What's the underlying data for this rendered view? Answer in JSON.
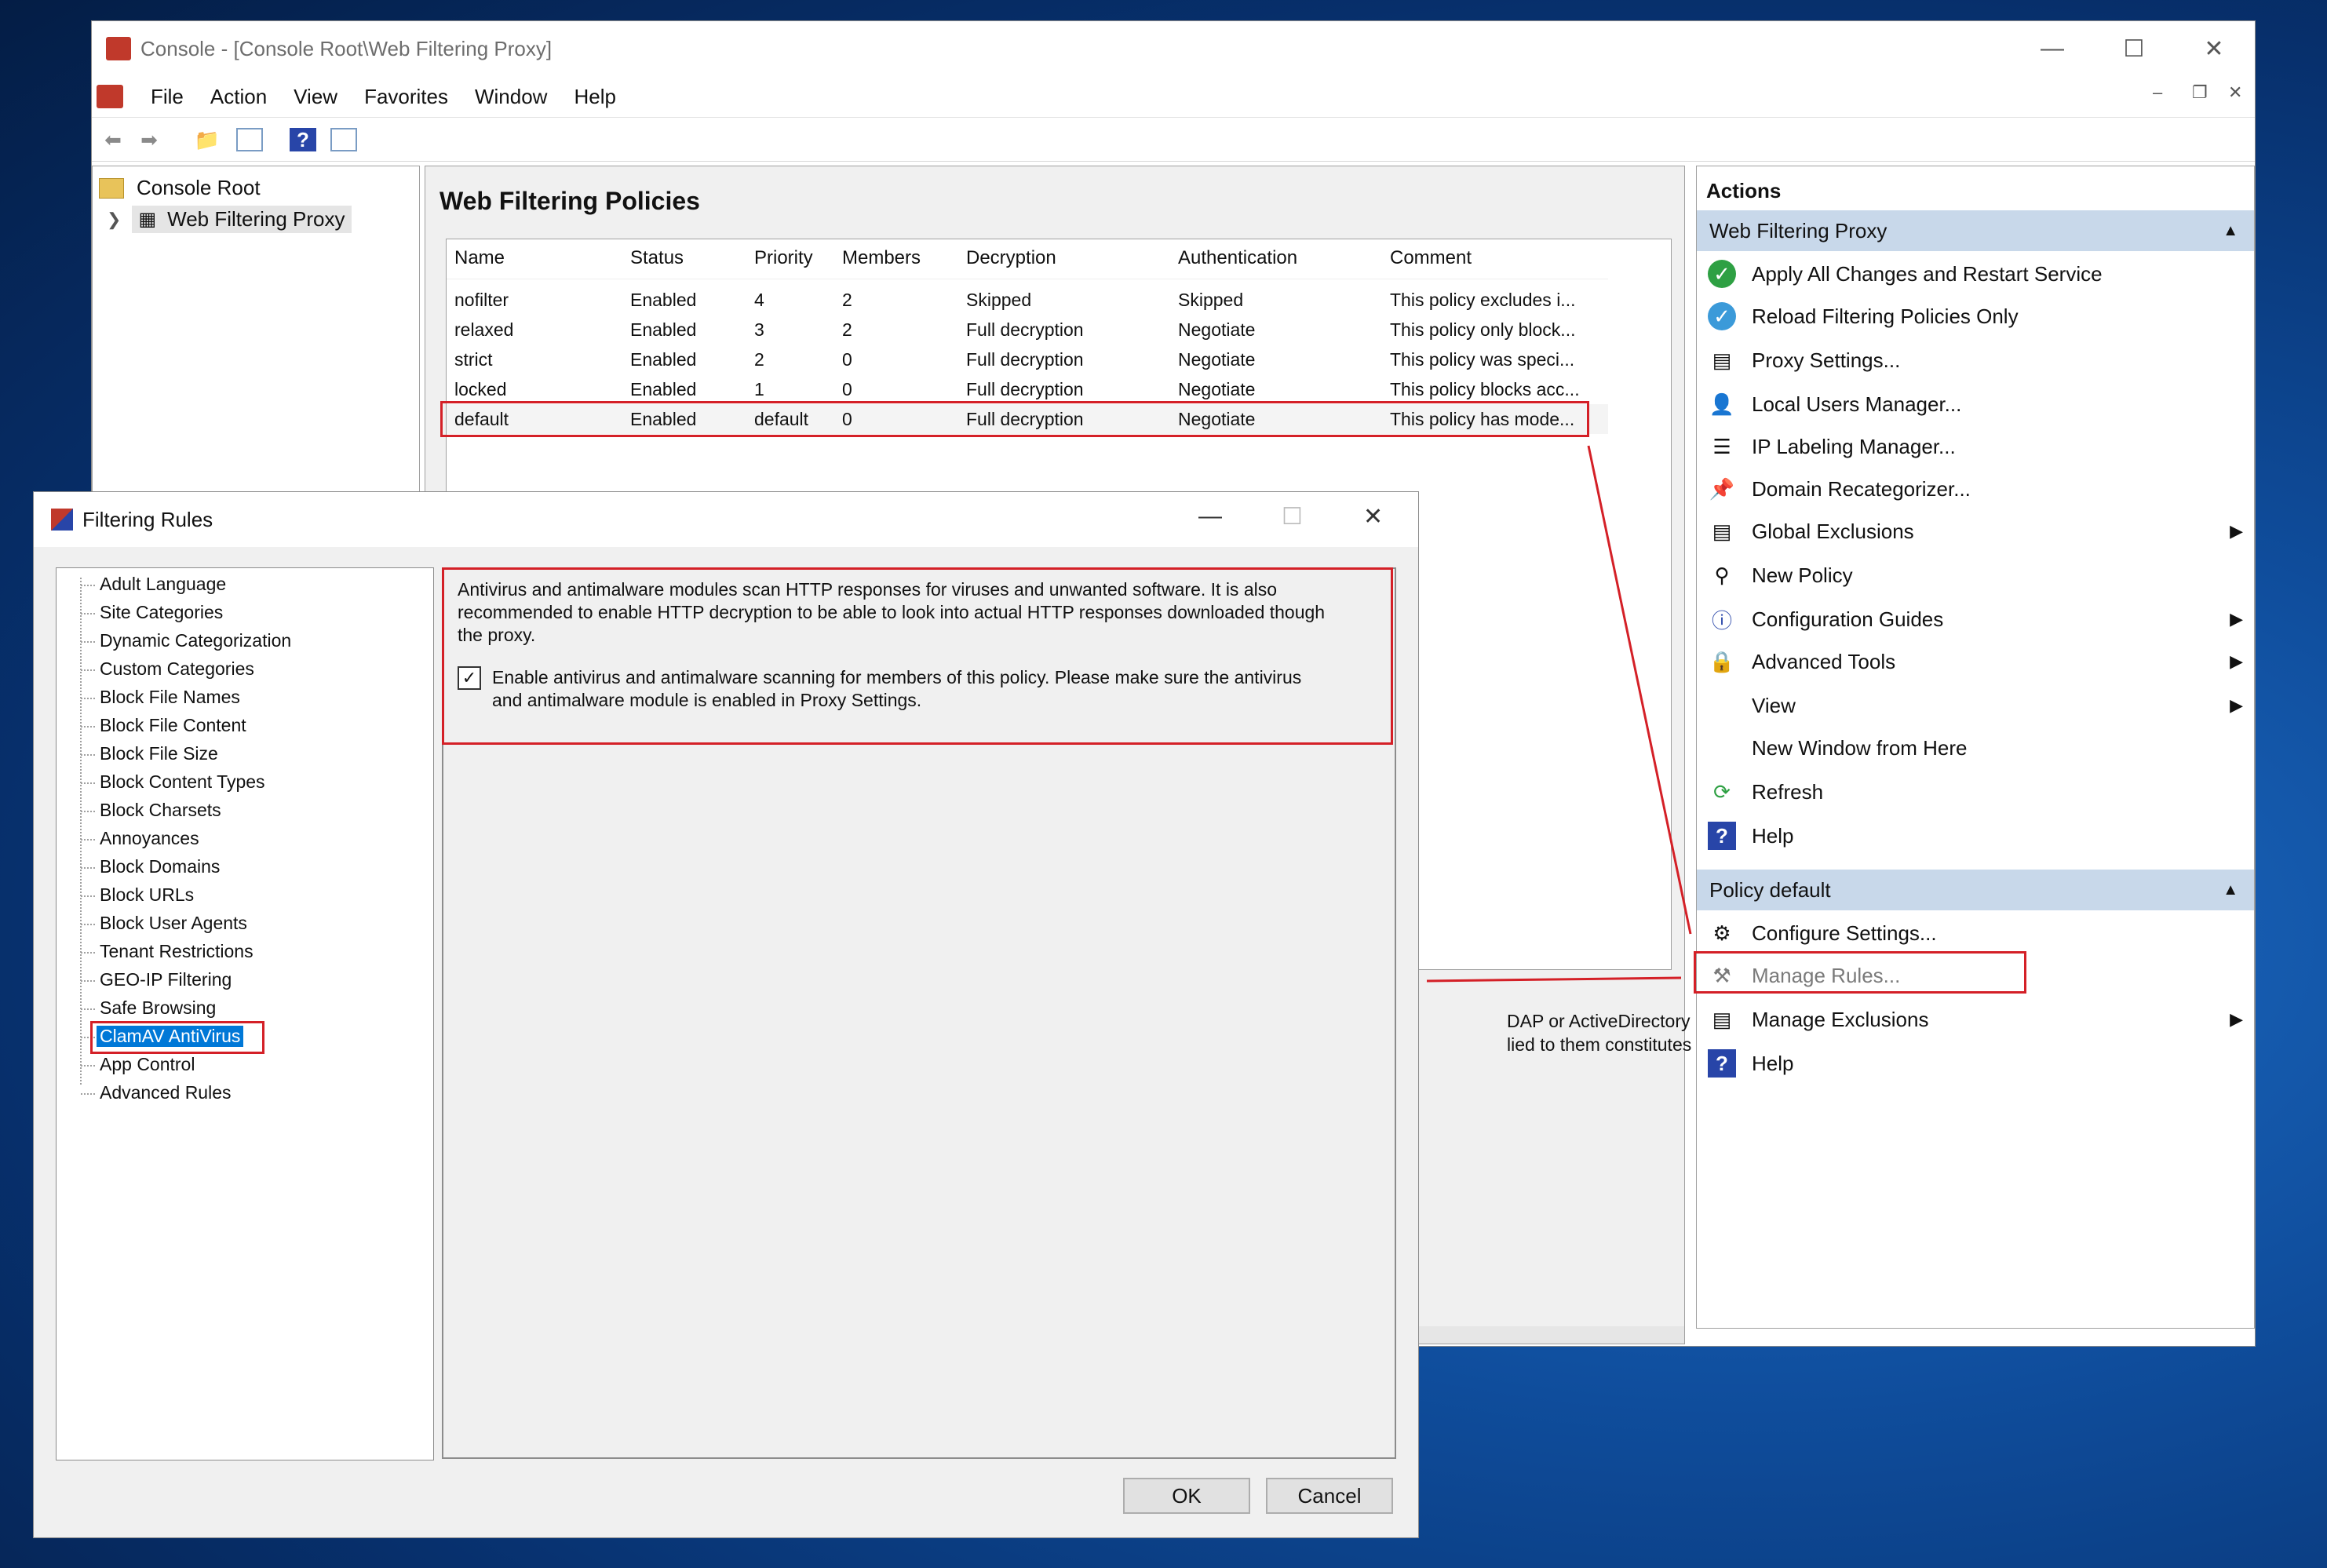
{
  "console": {
    "title": "Console - [Console Root\\Web Filtering Proxy]",
    "menu": [
      "File",
      "Action",
      "View",
      "Favorites",
      "Window",
      "Help"
    ],
    "tree": {
      "root": "Console Root",
      "child": "Web Filtering Proxy"
    },
    "center": {
      "title": "Web Filtering Policies",
      "columns": [
        "Name",
        "Status",
        "Priority",
        "Members",
        "Decryption",
        "Authentication",
        "Comment"
      ],
      "rows": [
        [
          "nofilter",
          "Enabled",
          "4",
          "2",
          "Skipped",
          "Skipped",
          "This policy excludes i..."
        ],
        [
          "relaxed",
          "Enabled",
          "3",
          "2",
          "Full decryption",
          "Negotiate",
          "This policy only block..."
        ],
        [
          "strict",
          "Enabled",
          "2",
          "0",
          "Full decryption",
          "Negotiate",
          "This policy was speci..."
        ],
        [
          "locked",
          "Enabled",
          "1",
          "0",
          "Full decryption",
          "Negotiate",
          "This policy blocks acc..."
        ],
        [
          "default",
          "Enabled",
          "default",
          "0",
          "Full decryption",
          "Negotiate",
          "This policy has mode..."
        ]
      ],
      "hidden_text_1": "DAP or ActiveDirectory",
      "hidden_text_2": "lied to them constitutes a"
    },
    "actions": {
      "title": "Actions",
      "group1": "Web Filtering Proxy",
      "items1": [
        "Apply All Changes and Restart Service",
        "Reload Filtering Policies Only",
        "Proxy Settings...",
        "Local Users Manager...",
        "IP Labeling Manager...",
        "Domain Recategorizer...",
        "Global Exclusions",
        "New Policy",
        "Configuration Guides",
        "Advanced Tools",
        "View",
        "New Window from Here",
        "Refresh",
        "Help"
      ],
      "group2": "Policy default",
      "items2": [
        "Configure Settings...",
        "Manage Rules...",
        "Manage Exclusions",
        "Help"
      ]
    }
  },
  "dialog": {
    "title": "Filtering Rules",
    "rules": [
      "Adult Language",
      "Site Categories",
      "Dynamic Categorization",
      "Custom Categories",
      "Block File Names",
      "Block File Content",
      "Block File Size",
      "Block Content Types",
      "Block Charsets",
      "Annoyances",
      "Block Domains",
      "Block URLs",
      "Block User Agents",
      "Tenant Restrictions",
      "GEO-IP Filtering",
      "Safe Browsing",
      "ClamAV AntiVirus",
      "App Control",
      "Advanced Rules"
    ],
    "selected_rule": "ClamAV AntiVirus",
    "description_line1": "Antivirus and antimalware modules scan HTTP responses for viruses and unwanted software.  It is also",
    "description_line2": "recommended to enable HTTP decryption to be able to look into actual HTTP responses downloaded though",
    "description_line3": "the proxy.",
    "checkbox_line1": "Enable antivirus and antimalware scanning for members of this policy. Please make sure the antivirus",
    "checkbox_line2": "and antimalware module is enabled in Proxy Settings.",
    "checkbox_checked": true,
    "ok_label": "OK",
    "cancel_label": "Cancel"
  },
  "colors": {
    "accent_red": "#d42027",
    "selection_blue": "#0078d7",
    "action_header": "#c8d8ea"
  }
}
